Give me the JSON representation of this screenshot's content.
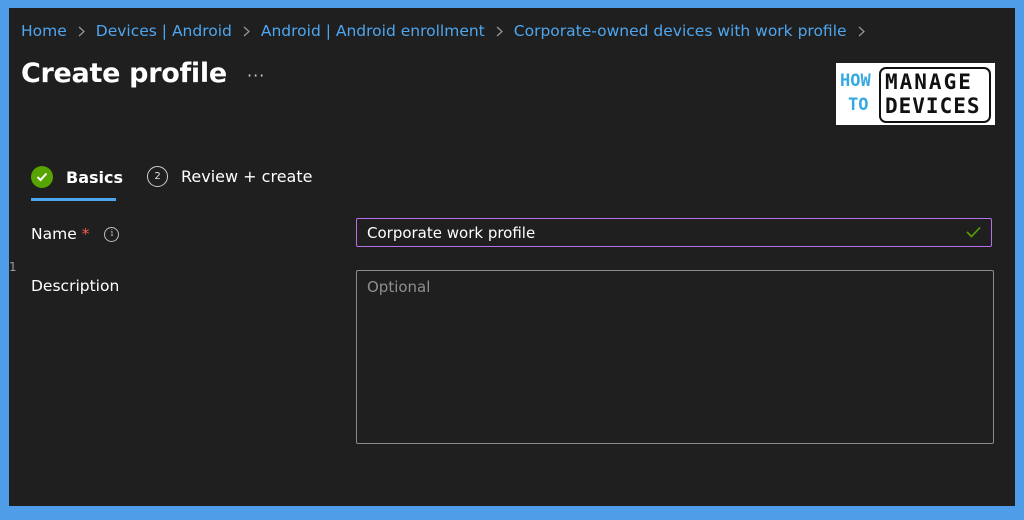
{
  "breadcrumb": {
    "items": [
      "Home",
      "Devices | Android",
      "Android | Android enrollment",
      "Corporate-owned devices with work profile"
    ]
  },
  "page": {
    "title": "Create profile",
    "more_label": "···"
  },
  "logo": {
    "line1": "HOW",
    "line2": "TO",
    "line3": "MANAGE",
    "line4": "DEVICES"
  },
  "tabs": [
    {
      "label": "Basics",
      "state": "completed"
    },
    {
      "label": "Review + create",
      "step": "2",
      "state": "pending"
    }
  ],
  "form": {
    "name_label": "Name",
    "required_mark": "*",
    "name_value": "Corporate work profile",
    "description_label": "Description",
    "description_placeholder": "Optional"
  },
  "stray_text": "1",
  "colors": {
    "accent": "#4ea6ef",
    "background": "#1f1f1f",
    "frame": "#4f9de8",
    "success": "#57a300",
    "input_focus": "#b76ee8",
    "required": "#ff5a4e"
  }
}
